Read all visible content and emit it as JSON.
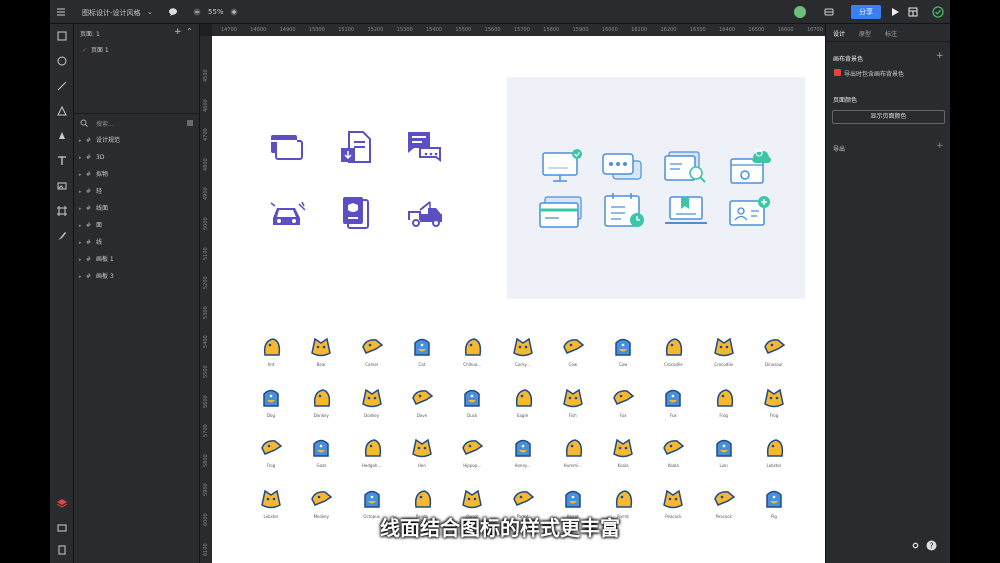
{
  "topbar": {
    "doc_title": "图标设计-设计风格",
    "zoom": "55%",
    "share_label": "分享"
  },
  "layers": {
    "pages_label": "页面",
    "pages_count": ": 1",
    "page_item": "页面 1",
    "search_placeholder": "搜索...",
    "items": [
      {
        "label": "设计规范"
      },
      {
        "label": "3D"
      },
      {
        "label": "拟物"
      },
      {
        "label": "轻"
      },
      {
        "label": "线面"
      },
      {
        "label": "面"
      },
      {
        "label": "线"
      },
      {
        "label": "画板 1"
      },
      {
        "label": "画板 3"
      }
    ]
  },
  "ruler": {
    "h": [
      "14700",
      "14800",
      "14900",
      "15000",
      "15100",
      "15200",
      "15300",
      "15400",
      "15500",
      "15600",
      "15700",
      "15800",
      "15900",
      "16000",
      "16100",
      "16200",
      "16300",
      "16400",
      "16500",
      "16600",
      "16700"
    ],
    "v": [
      "4500",
      "4600",
      "4700",
      "4800",
      "4900",
      "5000",
      "5100",
      "5200",
      "5300",
      "5400",
      "5500",
      "5600",
      "5700",
      "5800",
      "5900",
      "6000",
      "6100",
      "6200"
    ]
  },
  "rpanel": {
    "tabs": [
      "设计",
      "原型",
      "标注"
    ],
    "canvas_bg_title": "画布背景色",
    "export_with_bg": "导出时包含画布背景色",
    "page_color_title": "页面颜色",
    "show_page_color": "显示页面颜色",
    "export_title": "导出"
  },
  "animals": [
    [
      "Ant",
      "Bear",
      "Camel",
      "Cat",
      "Chihua...",
      "Cocky...",
      "Cow",
      "Cow",
      "Crocodile",
      "Crocodile",
      "Dinosaur"
    ],
    [
      "Dog",
      "Donkey",
      "Donkey",
      "Dove",
      "Duck",
      "Eagle",
      "Fish",
      "Fox",
      "Fox",
      "Frog",
      "Frog"
    ],
    [
      "Frog",
      "Goat",
      "Hedgeh...",
      "Hen",
      "Hippop...",
      "Honey...",
      "Hummi...",
      "Koala",
      "Koala",
      "Lion",
      "Lobster"
    ],
    [
      "Lobster",
      "Monkey",
      "Octopus",
      "Panda",
      "Parrot",
      "Parrot",
      "Parrot",
      "Parrot",
      "Peacock",
      "Peacock",
      "Pig"
    ]
  ],
  "caption": "线面结合图标的样式更丰富",
  "colors": {
    "accent": "#3b7ff5",
    "icon_purple": "#5b4fc4",
    "icon_blue": "#4a90d9",
    "animal_yellow": "#f5b82e",
    "animal_navy": "#1f4a8a",
    "frame_bg": "#eef1f7"
  }
}
